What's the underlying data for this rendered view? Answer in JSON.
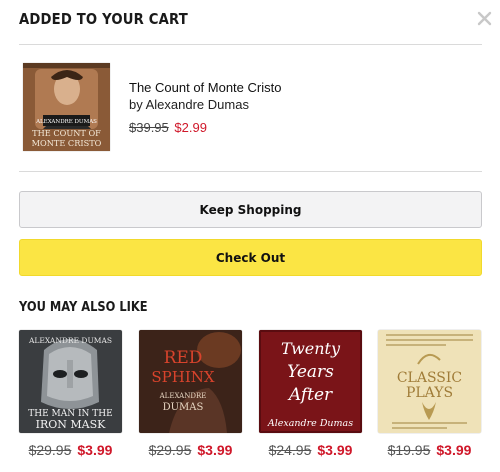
{
  "header": {
    "title": "ADDED TO YOUR CART",
    "close_icon": "close-icon"
  },
  "cart_item": {
    "title": "The Count of Monte Cristo",
    "author": "by Alexandre Dumas",
    "old_price": "$39.95",
    "new_price": "$2.99",
    "cover": {
      "top_text": "ALEXANDRE DUMAS",
      "line1": "THE COUNT OF",
      "line2": "MONTE CRISTO"
    }
  },
  "buttons": {
    "keep_shopping": "Keep Shopping",
    "check_out": "Check Out"
  },
  "recommendations": {
    "title": "YOU MAY ALSO LIKE",
    "items": [
      {
        "old_price": "$29.95",
        "new_price": "$3.99",
        "cover": {
          "top": "ALEXANDRE DUMAS",
          "line1": "THE MAN IN THE",
          "line2": "IRON MASK"
        }
      },
      {
        "old_price": "$29.95",
        "new_price": "$3.99",
        "cover": {
          "line1": "RED",
          "line2": "SPHINX",
          "author1": "ALEXANDRE",
          "author2": "DUMAS"
        }
      },
      {
        "old_price": "$24.95",
        "new_price": "$3.99",
        "cover": {
          "line1": "Twenty",
          "line2": "Years",
          "line3": "After",
          "author": "Alexandre Dumas"
        }
      },
      {
        "old_price": "$19.95",
        "new_price": "$3.99",
        "cover": {
          "line1": "CLASSIC",
          "line2": "PLAYS"
        }
      }
    ]
  },
  "colors": {
    "sale_red": "#d0182a",
    "checkout_yellow": "#fbe544",
    "keep_gray": "#f3f3f4"
  }
}
